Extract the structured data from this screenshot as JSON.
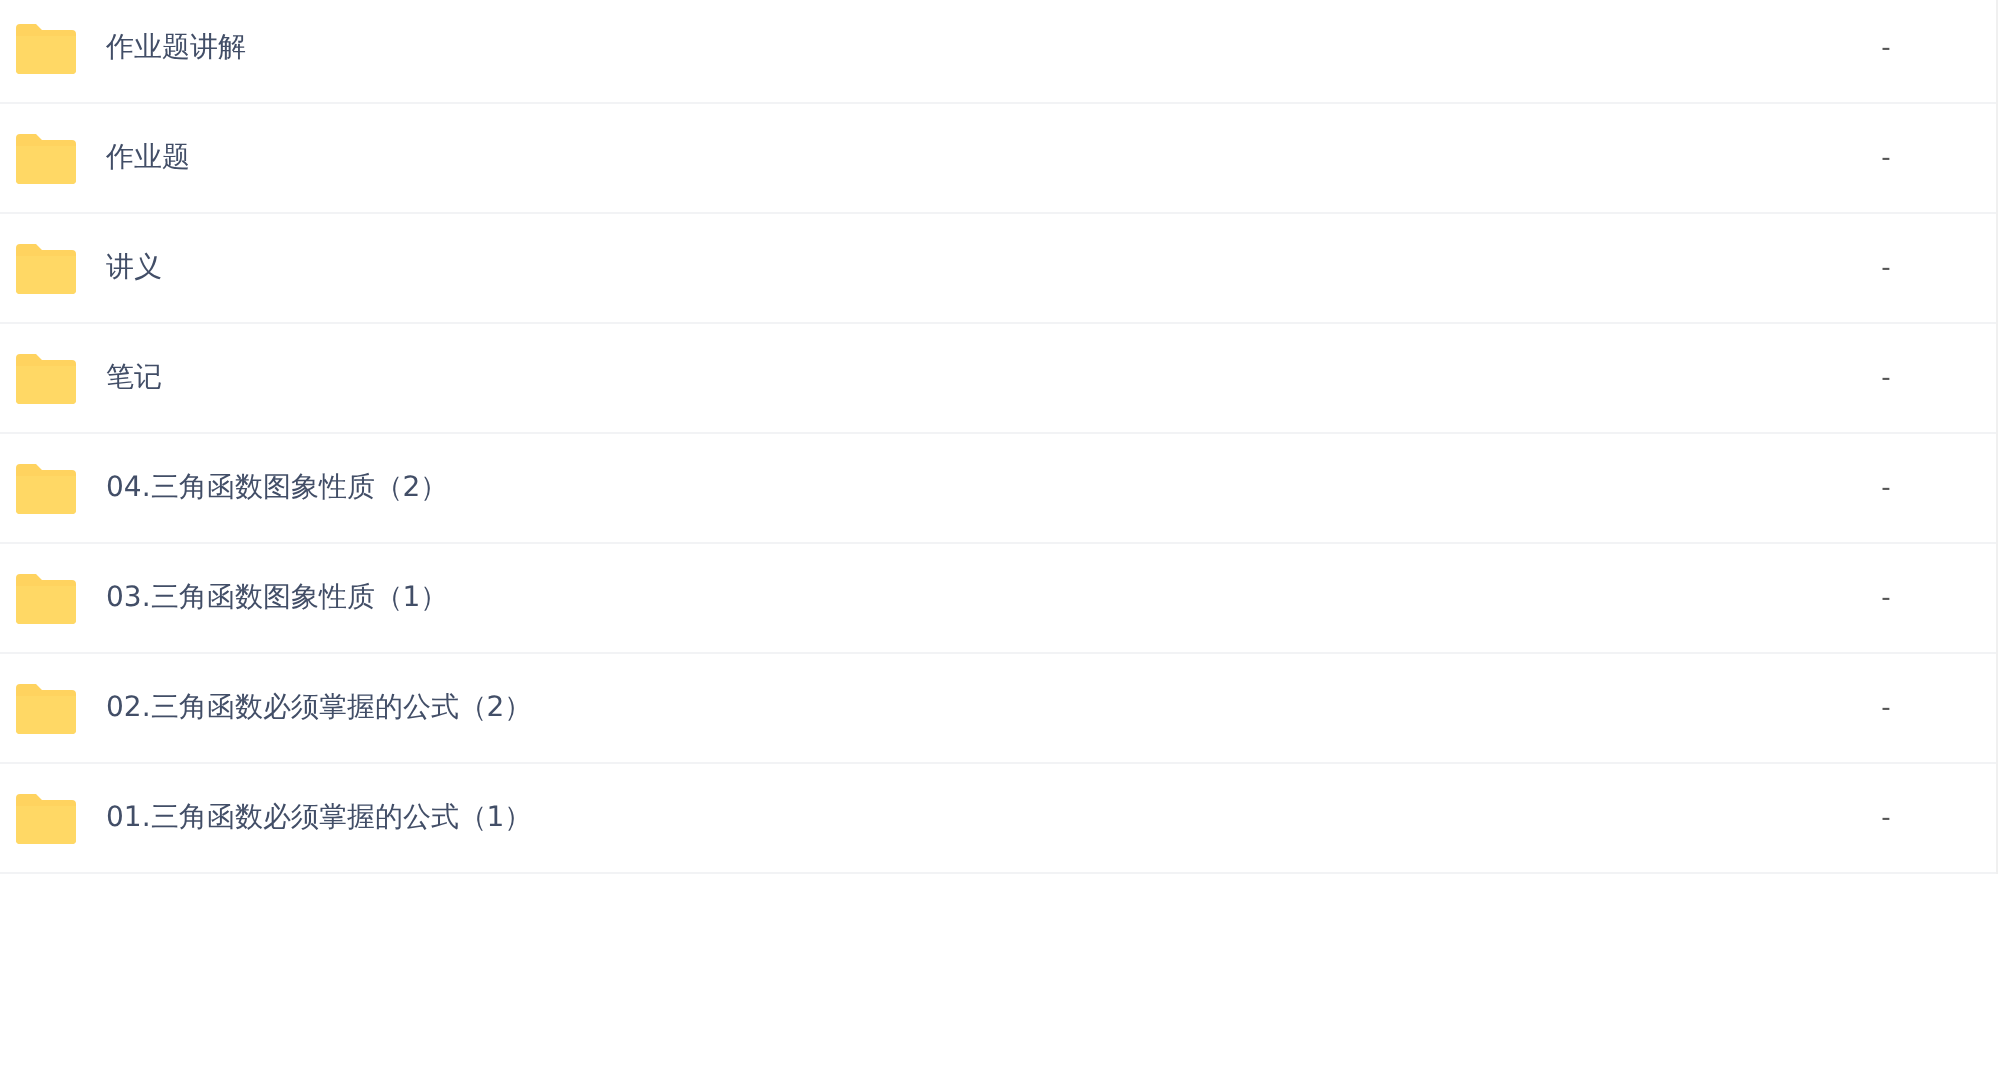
{
  "files": [
    {
      "name": "作业题讲解",
      "size": "-"
    },
    {
      "name": "作业题",
      "size": "-"
    },
    {
      "name": "讲义",
      "size": "-"
    },
    {
      "name": "笔记",
      "size": "-"
    },
    {
      "name": "04.三角函数图象性质（2）",
      "size": "-"
    },
    {
      "name": "03.三角函数图象性质（1）",
      "size": "-"
    },
    {
      "name": "02.三角函数必须掌握的公式（2）",
      "size": "-"
    },
    {
      "name": "01.三角函数必须掌握的公式（1）",
      "size": "-"
    }
  ]
}
